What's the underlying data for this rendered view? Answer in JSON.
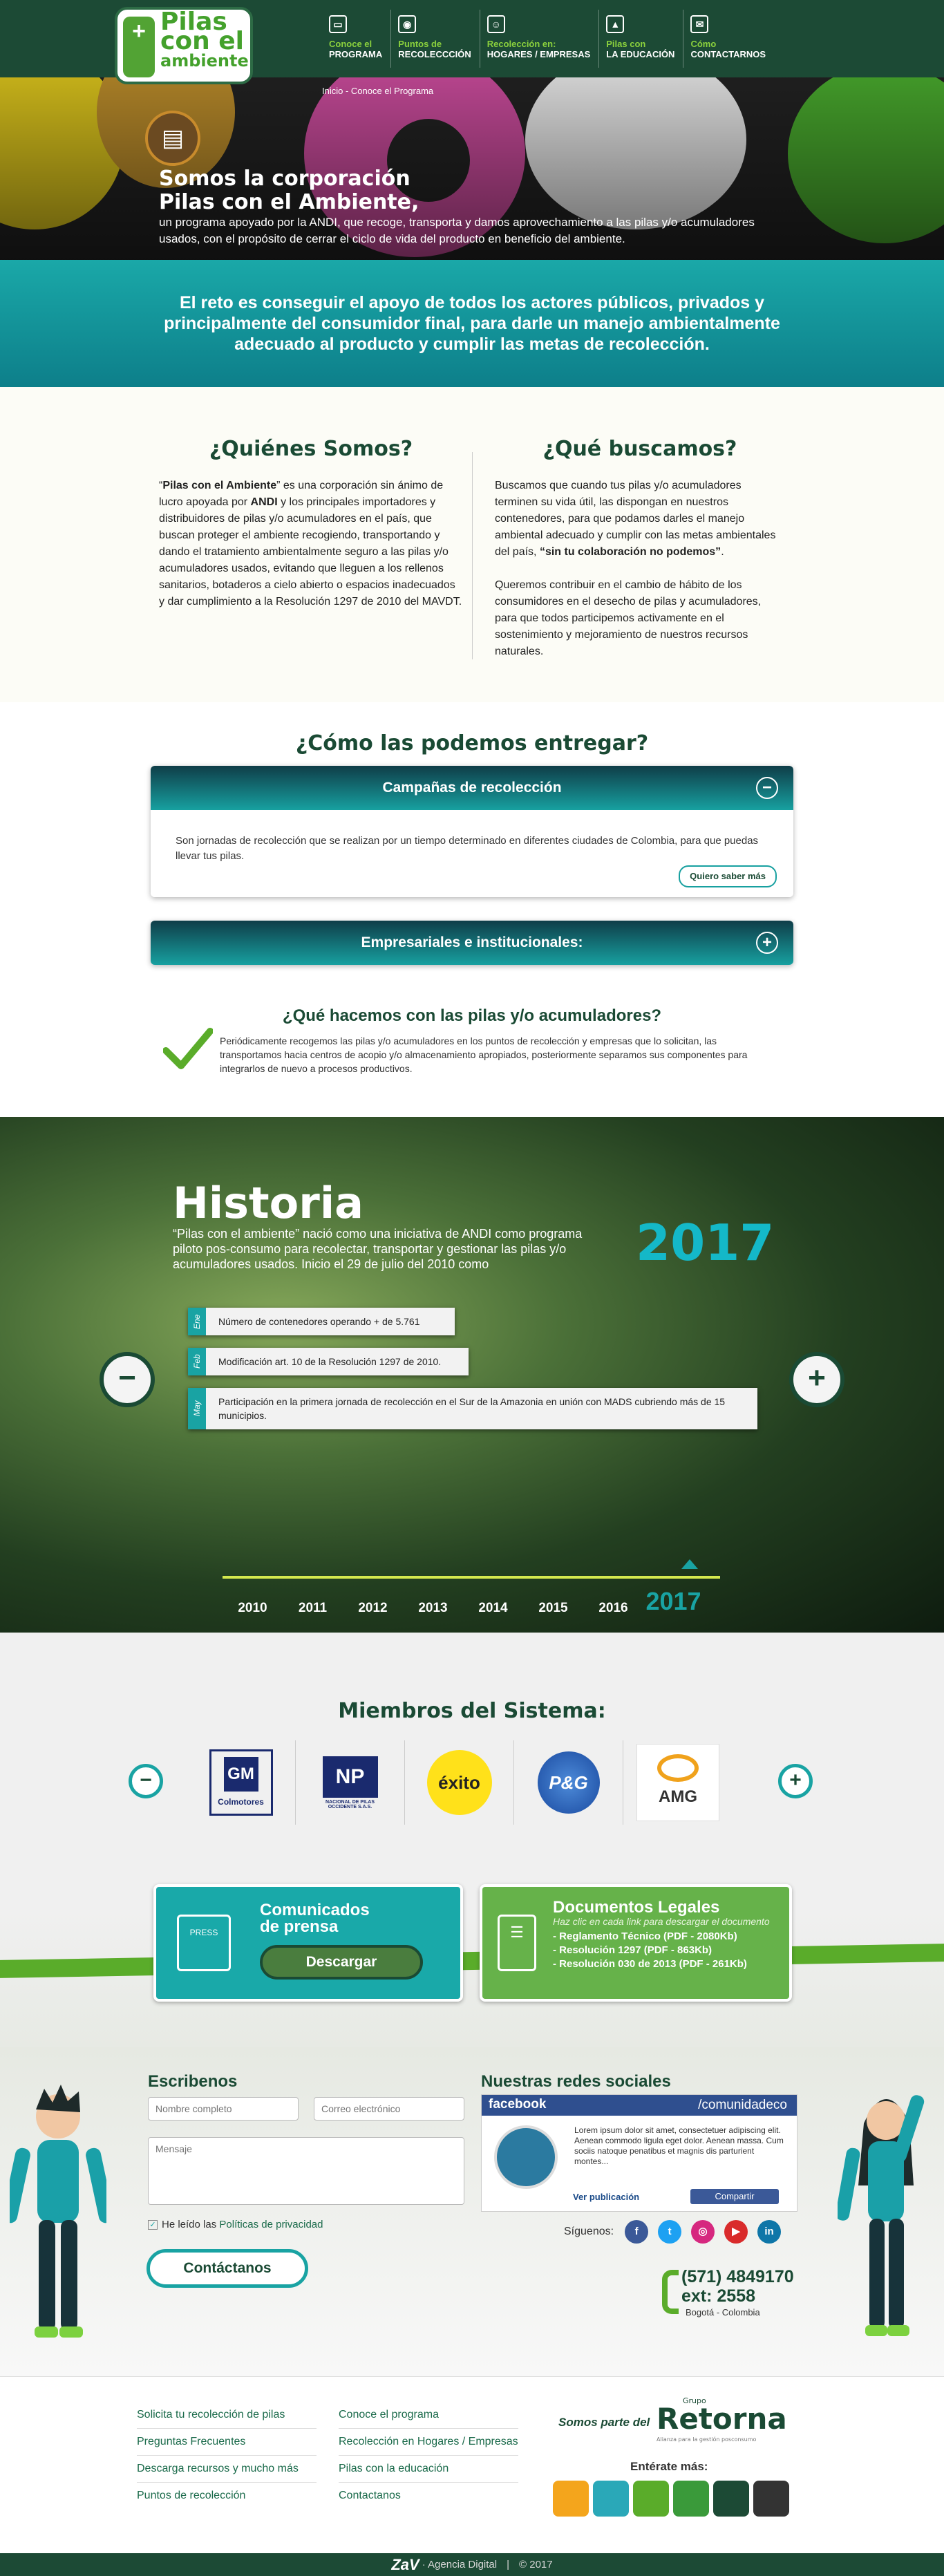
{
  "logo": {
    "line1": "Pilas",
    "line2": "con el",
    "line3": "ambiente",
    "badge": "+"
  },
  "nav": [
    {
      "l1": "Conoce el",
      "l2": "PROGRAMA",
      "icon": "book-icon"
    },
    {
      "l1": "Puntos de",
      "l2": "RECOLECCCIÓN",
      "icon": "location-icon"
    },
    {
      "l1": "Recolección en:",
      "l2": "HOGARES / EMPRESAS",
      "icon": "person-icon"
    },
    {
      "l1": "Pilas con",
      "l2": "LA EDUCACIÓN",
      "icon": "graduation-cap-icon"
    },
    {
      "l1": "Cómo",
      "l2": "CONTACTARNOS",
      "icon": "envelope-icon"
    }
  ],
  "breadcrumb": {
    "home": "Inicio",
    "sep": " - ",
    "current": "Conoce el Programa"
  },
  "hero": {
    "title1": "Somos la corporación",
    "title2": "Pilas con el Ambiente,",
    "subtitle": "un programa apoyado por la ANDI, que recoge, transporta y damos aprovechamiento a las pilas y/o acumuladores usados, con el propósito de cerrar el ciclo de vida del producto en beneficio del ambiente."
  },
  "reto": "El reto es conseguir el apoyo de todos los actores públicos, privados y principalmente del consumidor final, para darle un manejo ambientalmente adecuado al producto y cumplir las metas de recolección.",
  "quienes": {
    "title": "¿Quiénes Somos?",
    "p_pre": "“",
    "p_b1": "Pilas con el Ambiente",
    "p_mid": "” es una corporación sin ánimo de lucro apoyada por ",
    "p_b2": "ANDI",
    "p_post": " y los principales importadores y distribuidores de pilas y/o acumuladores en el país, que buscan proteger el ambiente recogiendo, transportando y dando el tratamiento ambientalmente seguro a las pilas y/o acumuladores usados, evitando que lleguen a los rellenos sanitarios, botaderos a cielo abierto o espacios inadecuados y dar cumplimiento a la Resolución 1297 de 2010 del MAVDT."
  },
  "buscamos": {
    "title": "¿Qué buscamos?",
    "p1_pre": "Buscamos que cuando tus pilas y/o acumuladores terminen su vida útil, las dispongan en nuestros contenedores, para que podamos darles el manejo ambiental adecuado y cumplir con las metas ambientales del país, ",
    "p1_b": "“sin tu colaboración no podemos”",
    "p1_post": ".",
    "p2": "Queremos contribuir en el cambio de hábito de los consumidores en el desecho de pilas y acumuladores, para que todos participemos activamente en el sostenimiento y mejoramiento de nuestros recursos naturales."
  },
  "entregar": {
    "title": "¿Cómo las podemos entregar?",
    "acc1_title": "Campañas de recolección",
    "acc1_toggle": "−",
    "acc1_body": "Son jornadas de recolección que se realizan por un tiempo determinado en diferentes ciudades de Colombia, para que puedas llevar tus pilas.",
    "acc1_btn": "Quiero saber más",
    "acc2_title": "Empresariales e institucionales:",
    "acc2_toggle": "+"
  },
  "hacemos": {
    "title": "¿Qué hacemos con las pilas y/o acumuladores?",
    "text": "Periódicamente recogemos las pilas y/o acumuladores en los puntos de recolección y empresas que lo solicitan, las transportamos hacia centros de acopio y/o almacenamiento apropiados, posteriormente separamos sus componentes para integrarlos de nuevo a procesos productivos."
  },
  "historia": {
    "title": "Historia",
    "text": "“Pilas con el ambiente” nació como una iniciativa de ANDI como programa piloto pos-consumo para recolectar, transportar y gestionar las pilas y/o acumuladores usados. Inicio el 29 de julio del 2010 como",
    "year": "2017",
    "events": [
      {
        "month": "Ene",
        "text": "Número de contenedores operando + de 5.761"
      },
      {
        "month": "Feb",
        "text": "Modificación art. 10 de la Resolución 1297 de 2010."
      },
      {
        "month": "May",
        "text": "Participación en la primera jornada de recolección en el Sur de la Amazonia en  unión con MADS cubriendo más de 15 municipios."
      }
    ],
    "prev": "−",
    "next": "+",
    "years": [
      "2010",
      "2011",
      "2012",
      "2013",
      "2014",
      "2015",
      "2016",
      "2017"
    ]
  },
  "miembros": {
    "title": "Miembros del Sistema:",
    "prev": "−",
    "next": "+",
    "logos": [
      {
        "name": "GM",
        "sub": "Colmotores"
      },
      {
        "name": "NP",
        "sub": "NACIONAL DE PILAS OCCIDENTE S.A.S."
      },
      {
        "name": "éxito",
        "sub": ""
      },
      {
        "name": "P&G",
        "sub": ""
      },
      {
        "name": "AMG",
        "sub": ""
      }
    ]
  },
  "comunicados": {
    "title1": "Comunicados",
    "title2": "de prensa",
    "btn": "Descargar",
    "icon_label": "PRESS"
  },
  "documentos": {
    "title": "Documentos Legales",
    "note": "Haz clic en cada link para descargar el documento",
    "items": [
      "- Reglamento Técnico (PDF - 2080Kb)",
      "- Resolución 1297 (PDF - 863Kb)",
      "- Resolución 030 de 2013 (PDF - 261Kb)"
    ]
  },
  "contacto": {
    "title": "Escribenos",
    "name_ph": "Nombre completo",
    "email_ph": "Correo electrónico",
    "msg_ph": "Mensaje",
    "check_label": "He leído las ",
    "check_link": "Políticas de privacidad",
    "btn": "Contáctanos"
  },
  "redes": {
    "title": "Nuestras redes sociales",
    "fb_brand": "facebook",
    "fb_page": "/comunidadeco",
    "fb_text": "Lorem ipsum dolor sit amet, consectetuer adipiscing elit. Aenean commodo ligula eget dolor. Aenean massa. Cum sociis natoque penatibus et magnis dis parturient montes...",
    "fb_ver": "Ver publicación",
    "fb_share": "Compartir",
    "siguenos": "Síguenos:",
    "networks": [
      "f",
      "t",
      "◎",
      "▶",
      "in"
    ]
  },
  "telefono": {
    "n1": "(571) 4849170",
    "n2": "ext: 2558",
    "city": "Bogotá - Colombia"
  },
  "footer": {
    "col1": [
      "Solicita tu recolección de pilas",
      "Preguntas Frecuentes",
      "Descarga recursos y mucho más",
      "Puntos de recolección"
    ],
    "col2": [
      "Conoce el programa",
      "Recolección en Hogares / Empresas",
      "Pilas con la educación",
      "Contactanos"
    ],
    "somos": "Somos parte del",
    "grupo": "Grupo",
    "retorna": "Retorna",
    "retorna_sub": "Alianza para la gestión posconsumo",
    "enterate": "Entérate más:",
    "apps": [
      "",
      "",
      "",
      "",
      "",
      ""
    ]
  },
  "bottom": {
    "agency": "ZaV",
    "agency_label": "· Agencia Digital",
    "sep": "|",
    "copy": "© 2017"
  },
  "colors": {
    "primary": "#1c4a35",
    "teal": "#19a3a3",
    "green": "#5aac2a"
  }
}
